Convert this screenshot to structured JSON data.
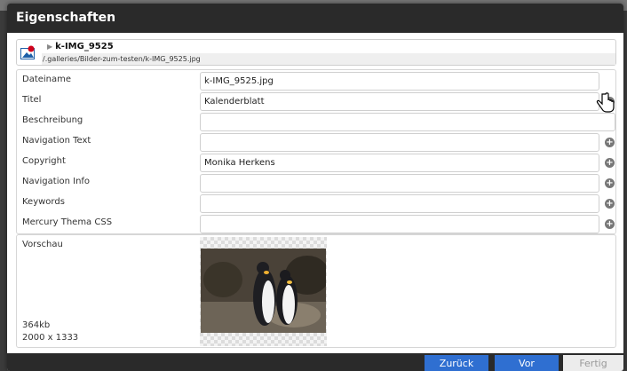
{
  "dialog": {
    "title": "Eigenschaften"
  },
  "resource": {
    "name": "k-IMG_9525",
    "path": "/.galleries/Bilder-zum-testen/k-IMG_9525.jpg",
    "icon": "image-file-icon"
  },
  "fields": [
    {
      "label": "Dateiname",
      "value": "k-IMG_9525.jpg",
      "has_add": false
    },
    {
      "label": "Titel",
      "value": "Kalenderblatt",
      "has_add": true
    },
    {
      "label": "Beschreibung",
      "value": "",
      "has_add": false
    },
    {
      "label": "Navigation Text",
      "value": "",
      "has_add": true
    },
    {
      "label": "Copyright",
      "value": "Monika Herkens",
      "has_add": true
    },
    {
      "label": "Navigation Info",
      "value": "",
      "has_add": true
    },
    {
      "label": "Keywords",
      "value": "",
      "has_add": true
    },
    {
      "label": "Mercury Thema CSS",
      "value": "",
      "has_add": true
    }
  ],
  "preview": {
    "label": "Vorschau",
    "size": "364kb",
    "dimensions": "2000 x 1333"
  },
  "buttons": {
    "back": "Zurück",
    "next": "Vor",
    "done": "Fertig"
  },
  "colors": {
    "titlebar": "#2a2a2a",
    "primary_button": "#2f6fd1",
    "disabled_button": "#ececec"
  }
}
